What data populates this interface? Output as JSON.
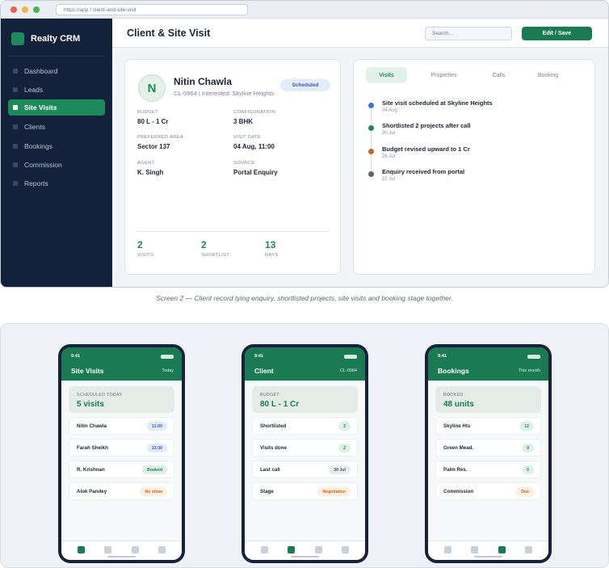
{
  "browser": {
    "url": "https://app  /  client-and-site-visit"
  },
  "sidebar": {
    "brand": "Realty CRM",
    "items": [
      {
        "label": "Dashboard",
        "active": false
      },
      {
        "label": "Leads",
        "active": false
      },
      {
        "label": "Site Visits",
        "active": true
      },
      {
        "label": "Clients",
        "active": false
      },
      {
        "label": "Bookings",
        "active": false
      },
      {
        "label": "Commission",
        "active": false
      },
      {
        "label": "Reports",
        "active": false
      }
    ]
  },
  "header": {
    "title": "Client & Site Visit",
    "search_placeholder": "Search...",
    "action_label": "Edit  /  Save"
  },
  "client": {
    "initial": "N",
    "name": "Nitin Chawla",
    "subtitle": "CL-0964  |  Interested: Skyline Heights",
    "status": "Scheduled",
    "fields": [
      {
        "label": "BUDGET",
        "value": "80 L - 1 Cr"
      },
      {
        "label": "CONFIGURATION",
        "value": "3 BHK"
      },
      {
        "label": "PREFERRED AREA",
        "value": "Sector 137"
      },
      {
        "label": "VISIT DATE",
        "value": "04 Aug, 11:00"
      },
      {
        "label": "AGENT",
        "value": "K. Singh"
      },
      {
        "label": "SOURCE",
        "value": "Portal Enquiry"
      }
    ],
    "stats": [
      {
        "value": "2",
        "label": "VISITS"
      },
      {
        "value": "2",
        "label": "SHORTLIST"
      },
      {
        "value": "13",
        "label": "DAYS"
      }
    ]
  },
  "activity": {
    "tabs": [
      {
        "label": "Visits",
        "active": true
      },
      {
        "label": "Properties",
        "active": false
      },
      {
        "label": "Calls",
        "active": false
      },
      {
        "label": "Booking",
        "active": false
      }
    ],
    "timeline": [
      {
        "title": "Site visit scheduled at Skyline Heights",
        "date": "04 Aug",
        "color": "#3b76d1"
      },
      {
        "title": "Shortlisted 2 projects after call",
        "date": "30 Jul",
        "color": "#1d8a5c"
      },
      {
        "title": "Budget revised upward to 1 Cr",
        "date": "26 Jul",
        "color": "#c26a23"
      },
      {
        "title": "Enquiry received from portal",
        "date": "22 Jul",
        "color": "#5b6475"
      }
    ]
  },
  "caption": "Screen 2 — Client record tying enquiry, shortlisted projects, site visits and booking stage together.",
  "phones": [
    {
      "time": "9:41",
      "title": "Site Visits",
      "meta": "Today",
      "hero_label": "SCHEDULED TODAY",
      "hero_value": "5 visits",
      "rows": [
        {
          "label": "Nitin Chawla",
          "badge": "11:00",
          "tone": "blue"
        },
        {
          "label": "Farah Sheikh",
          "badge": "13:30",
          "tone": "blue"
        },
        {
          "label": "R. Krishnan",
          "badge": "Booked",
          "tone": "green"
        },
        {
          "label": "Alok Pandey",
          "badge": "No show",
          "tone": "orange"
        }
      ],
      "active_nav": 0
    },
    {
      "time": "9:41",
      "title": "Client",
      "meta": "CL-0964",
      "hero_label": "BUDGET",
      "hero_value": "80 L - 1 Cr",
      "rows": [
        {
          "label": "Shortlisted",
          "badge": "2",
          "tone": "green"
        },
        {
          "label": "Visits done",
          "badge": "2",
          "tone": "green"
        },
        {
          "label": "Last call",
          "badge": "30 Jul",
          "tone": "gray"
        },
        {
          "label": "Stage",
          "badge": "Negotiation",
          "tone": "orange"
        }
      ],
      "active_nav": 1
    },
    {
      "time": "9:41",
      "title": "Bookings",
      "meta": "This month",
      "hero_label": "BOOKED",
      "hero_value": "48 units",
      "rows": [
        {
          "label": "Skyline Hts",
          "badge": "12",
          "tone": "green"
        },
        {
          "label": "Green Mead.",
          "badge": "9",
          "tone": "green"
        },
        {
          "label": "Palm Res.",
          "badge": "5",
          "tone": "green"
        },
        {
          "label": "Commission",
          "badge": "Due",
          "tone": "orange"
        }
      ],
      "active_nav": 2
    }
  ]
}
